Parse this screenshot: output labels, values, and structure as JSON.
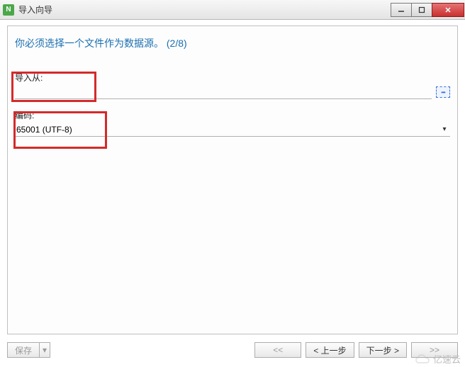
{
  "window": {
    "title": "导入向导"
  },
  "heading": "你必须选择一个文件作为数据源。 (2/8)",
  "fields": {
    "import_from": {
      "label": "导入从:",
      "value": ""
    },
    "encoding": {
      "label": "编码:",
      "value": "65001 (UTF-8)"
    }
  },
  "buttons": {
    "save": "保存",
    "first": "<<",
    "prev": "< 上一步",
    "next": "下一步 >",
    "last": ">>"
  },
  "watermark": "亿速云"
}
